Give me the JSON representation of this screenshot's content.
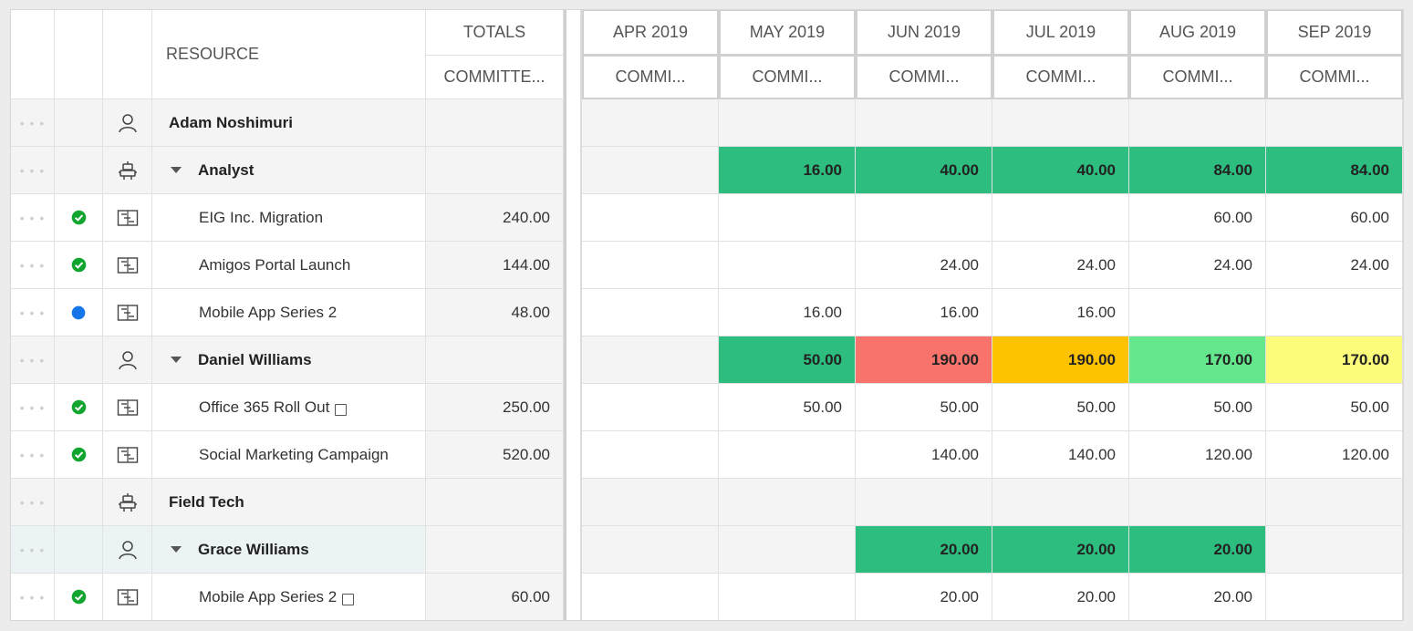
{
  "header": {
    "resource": "RESOURCE",
    "totals": "TOTALS",
    "totals_sub": "COMMITTE...",
    "months": [
      "APR 2019",
      "MAY 2019",
      "JUN 2019",
      "JUL 2019",
      "AUG 2019",
      "SEP 2019"
    ],
    "month_sub": "COMMI..."
  },
  "colors": {
    "green": "#2dbd7e",
    "red": "#f7736b",
    "orange": "#ffc200",
    "light_green": "#64e78c",
    "yellow": "#fcfb7b",
    "check": "#11a42e",
    "dot_blue": "#1476e8"
  },
  "rows": [
    {
      "type": "resource",
      "icon": "person-icon",
      "name": "Adam Noshimuri",
      "status": "",
      "total": "",
      "expand": false,
      "note": false,
      "values": [
        "",
        "",
        "",
        "",
        "",
        ""
      ],
      "colors": [
        "",
        "",
        "",
        "",
        "",
        ""
      ]
    },
    {
      "type": "role",
      "icon": "robot-icon",
      "name": "Analyst",
      "status": "",
      "total": "",
      "expand": true,
      "note": false,
      "values": [
        "",
        "16.00",
        "40.00",
        "40.00",
        "84.00",
        "84.00"
      ],
      "colors": [
        "",
        "green",
        "green",
        "green",
        "green",
        "green"
      ]
    },
    {
      "type": "project",
      "icon": "project-icon",
      "name": "EIG Inc. Migration",
      "status": "check",
      "total": "240.00",
      "expand": false,
      "note": false,
      "values": [
        "",
        "",
        "",
        "",
        "60.00",
        "60.00"
      ],
      "colors": [
        "",
        "",
        "",
        "",
        "",
        ""
      ]
    },
    {
      "type": "project",
      "icon": "project-icon",
      "name": "Amigos Portal Launch",
      "status": "check",
      "total": "144.00",
      "expand": false,
      "note": false,
      "values": [
        "",
        "",
        "24.00",
        "24.00",
        "24.00",
        "24.00"
      ],
      "colors": [
        "",
        "",
        "",
        "",
        "",
        ""
      ]
    },
    {
      "type": "project",
      "icon": "project-icon",
      "name": "Mobile App Series 2",
      "status": "dot",
      "total": "48.00",
      "expand": false,
      "note": false,
      "values": [
        "",
        "16.00",
        "16.00",
        "16.00",
        "",
        ""
      ],
      "colors": [
        "",
        "",
        "",
        "",
        "",
        ""
      ]
    },
    {
      "type": "resource",
      "icon": "person-icon",
      "name": "Daniel Williams",
      "status": "",
      "total": "",
      "expand": true,
      "note": false,
      "values": [
        "",
        "50.00",
        "190.00",
        "190.00",
        "170.00",
        "170.00"
      ],
      "colors": [
        "",
        "green",
        "red",
        "orange",
        "light_green",
        "yellow"
      ]
    },
    {
      "type": "project",
      "icon": "project-icon",
      "name": "Office 365 Roll Out",
      "status": "check",
      "total": "250.00",
      "expand": false,
      "note": true,
      "values": [
        "",
        "50.00",
        "50.00",
        "50.00",
        "50.00",
        "50.00"
      ],
      "colors": [
        "",
        "",
        "",
        "",
        "",
        ""
      ]
    },
    {
      "type": "project",
      "icon": "project-icon",
      "name": "Social Marketing Campaign",
      "status": "check",
      "total": "520.00",
      "expand": false,
      "note": false,
      "values": [
        "",
        "",
        "140.00",
        "140.00",
        "120.00",
        "120.00"
      ],
      "colors": [
        "",
        "",
        "",
        "",
        "",
        ""
      ]
    },
    {
      "type": "role",
      "icon": "robot-icon",
      "name": "Field Tech",
      "status": "",
      "total": "",
      "expand": false,
      "note": false,
      "values": [
        "",
        "",
        "",
        "",
        "",
        ""
      ],
      "colors": [
        "",
        "",
        "",
        "",
        "",
        ""
      ]
    },
    {
      "type": "resource",
      "icon": "person-icon",
      "name": "Grace Williams",
      "status": "",
      "total": "",
      "expand": true,
      "note": false,
      "highlight": true,
      "values": [
        "",
        "",
        "20.00",
        "20.00",
        "20.00",
        ""
      ],
      "colors": [
        "",
        "",
        "green",
        "green",
        "green",
        ""
      ]
    },
    {
      "type": "project",
      "icon": "project-icon",
      "name": "Mobile App Series 2",
      "status": "check",
      "total": "60.00",
      "expand": false,
      "note": true,
      "values": [
        "",
        "",
        "20.00",
        "20.00",
        "20.00",
        ""
      ],
      "colors": [
        "",
        "",
        "",
        "",
        "",
        ""
      ]
    }
  ]
}
